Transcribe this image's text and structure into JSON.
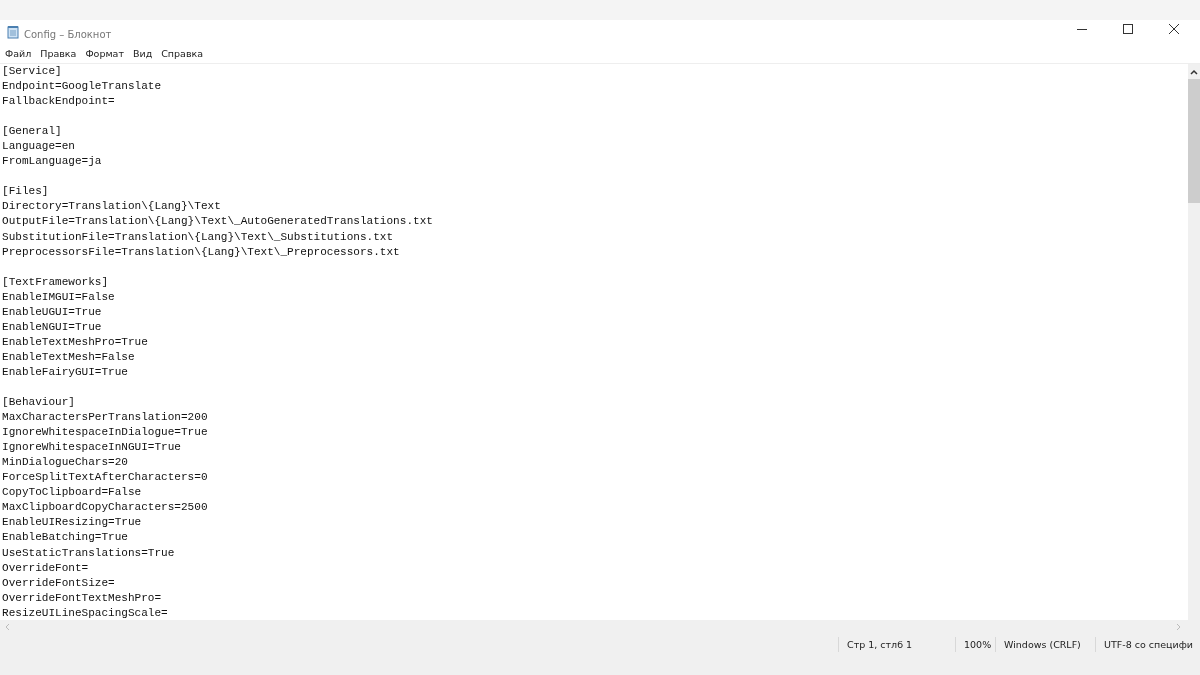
{
  "window": {
    "title": "Config – Блокнот"
  },
  "menu": [
    "Файл",
    "Правка",
    "Формат",
    "Вид",
    "Справка"
  ],
  "sections": [
    {
      "header": "[Service]",
      "entries": [
        "Endpoint=GoogleTranslate",
        "FallbackEndpoint="
      ]
    },
    {
      "header": "[General]",
      "entries": [
        "Language=en",
        "FromLanguage=ja"
      ]
    },
    {
      "header": "[Files]",
      "entries": [
        "Directory=Translation\\{Lang}\\Text",
        "OutputFile=Translation\\{Lang}\\Text\\_AutoGeneratedTranslations.txt",
        "SubstitutionFile=Translation\\{Lang}\\Text\\_Substitutions.txt",
        "PreprocessorsFile=Translation\\{Lang}\\Text\\_Preprocessors.txt"
      ]
    },
    {
      "header": "[TextFrameworks]",
      "entries": [
        "EnableIMGUI=False",
        "EnableUGUI=True",
        "EnableNGUI=True",
        "EnableTextMeshPro=True",
        "EnableTextMesh=False",
        "EnableFairyGUI=True"
      ]
    },
    {
      "header": "[Behaviour]",
      "entries": [
        "MaxCharactersPerTranslation=200",
        "IgnoreWhitespaceInDialogue=True",
        "IgnoreWhitespaceInNGUI=True",
        "MinDialogueChars=20",
        "ForceSplitTextAfterCharacters=0",
        "CopyToClipboard=False",
        "MaxClipboardCopyCharacters=2500",
        "EnableUIResizing=True",
        "EnableBatching=True",
        "UseStaticTranslations=True",
        "OverrideFont=",
        "OverrideFontSize=",
        "OverrideFontTextMeshPro=",
        "ResizeUILineSpacingScale="
      ]
    }
  ],
  "status_bar": {
    "position": "Стр 1, стлб 1",
    "zoom": "100%",
    "line_endings": "Windows (CRLF)",
    "encoding": "UTF-8 со специфи"
  }
}
